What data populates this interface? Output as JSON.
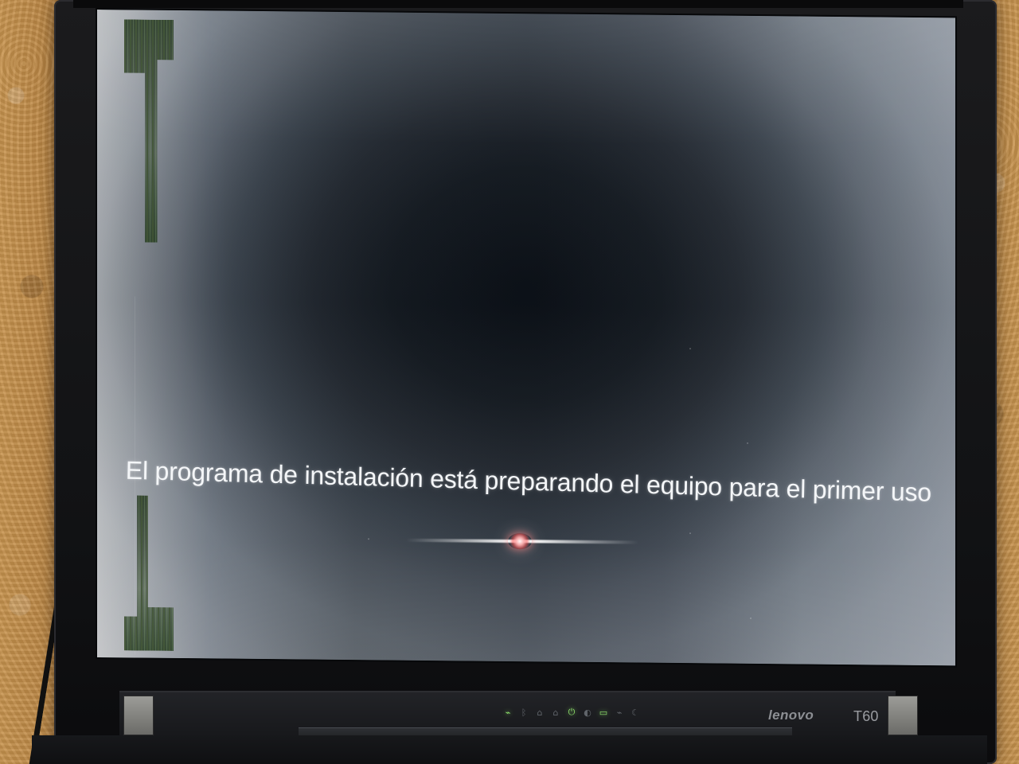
{
  "screen": {
    "message": "El programa de instalación está preparando el equipo para el primer uso"
  },
  "device": {
    "brand": "lenovo",
    "model": "T60"
  },
  "indicators": {
    "wifi": "wifi-icon",
    "bluetooth": "bluetooth-icon",
    "drive_1": "drive-icon",
    "drive_2": "drive-icon",
    "power": "power-icon",
    "standby": "standby-icon",
    "battery": "battery-icon",
    "plug": "plug-icon",
    "moon": "moon-icon"
  },
  "colors": {
    "led_green": "#8fe26d",
    "glow_red": "#ff6b6b"
  },
  "progress": {
    "state": "indeterminate"
  }
}
